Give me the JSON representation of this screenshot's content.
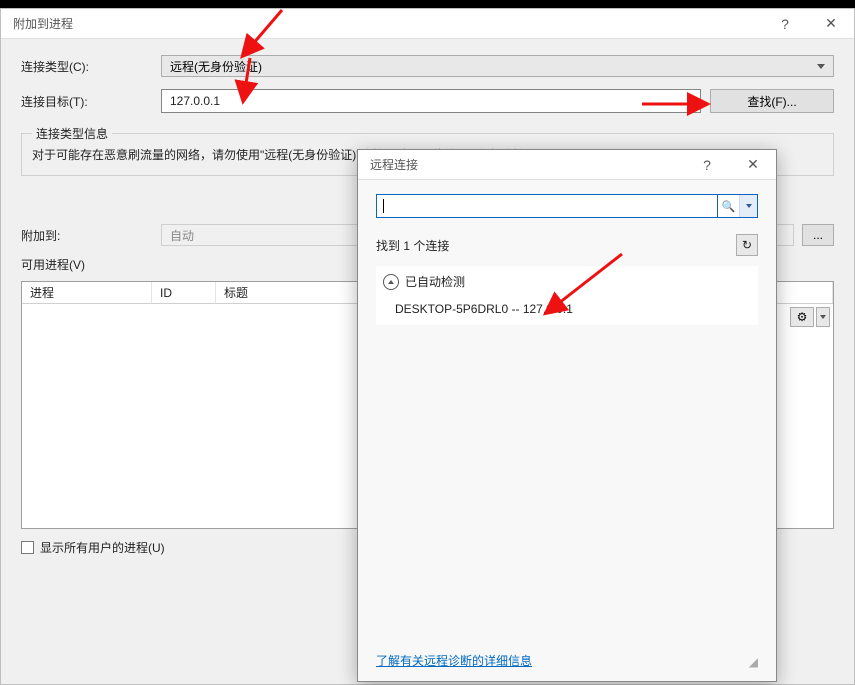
{
  "mainDialog": {
    "title": "附加到进程",
    "connectionTypeLabel": "连接类型(C):",
    "connectionTypeValue": "远程(无身份验证)",
    "connectionTargetLabel": "连接目标(T):",
    "connectionTargetValue": "127.0.0.1",
    "findButton": "查找(F)...",
    "infoGroupTitle": "连接类型信息",
    "infoText": "对于可能存在恶意刷流量的网络，请勿使用\"远程(无身份验证)\"连接。请尽可能使用\"默认\"连接",
    "attachToLabel": "附加到:",
    "attachToValue": "自动",
    "availableLabel": "可用进程(V)",
    "columns": {
      "process": "进程",
      "id": "ID",
      "title": "标题"
    },
    "showAllUsers": "显示所有用户的进程(U)"
  },
  "popup": {
    "title": "远程连接",
    "foundLabel": "找到 1 个连接",
    "groupLabel": "已自动检测",
    "resultItem": "DESKTOP-5P6DRL0 -- 127.0.0.1",
    "link": "了解有关远程诊断的详细信息"
  },
  "icons": {
    "searchGlyph": "🔍",
    "gearGlyph": "⚙",
    "refreshGlyph": "↻",
    "ellipsis": "..."
  }
}
